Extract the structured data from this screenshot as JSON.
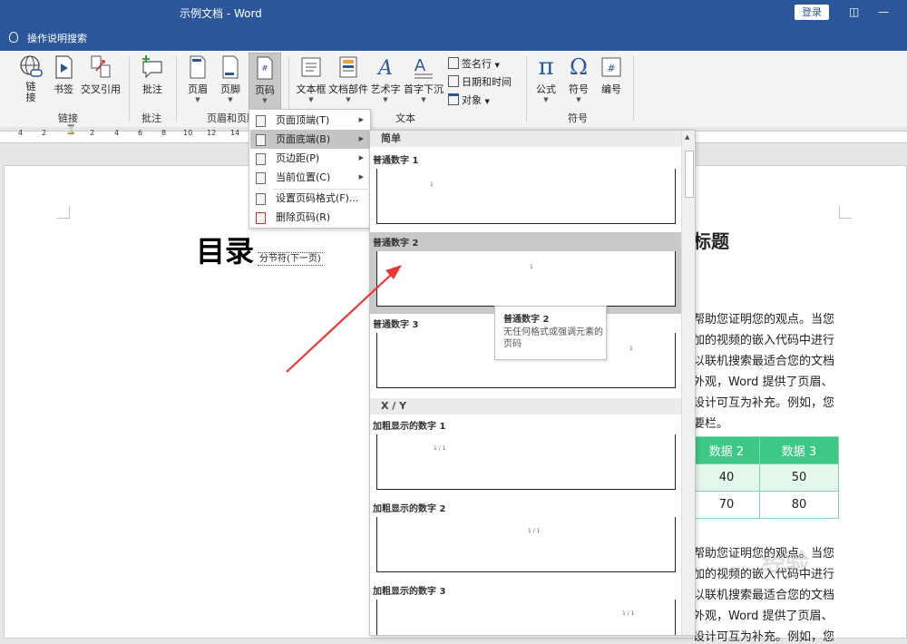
{
  "window": {
    "title": "示例文档 - Word",
    "login_label": "登录",
    "restore_icon": "ribbon-display-icon",
    "minimize_icon": "minimize-icon"
  },
  "tellme": {
    "label": "操作说明搜索"
  },
  "ribbon": {
    "links_group": {
      "label": "链接",
      "buttons": [
        "链\n接",
        "书签",
        "交叉引用"
      ]
    },
    "comments_group": {
      "label": "批注",
      "buttons": [
        "批注"
      ]
    },
    "header_footer_group": {
      "label": "页眉和页脚",
      "buttons": [
        "页眉",
        "页脚",
        "页码"
      ]
    },
    "text_group": {
      "label": "文本",
      "buttons": [
        "文本框",
        "文档部件",
        "艺术字",
        "首字下沉"
      ],
      "small_buttons": [
        "签名行",
        "日期和时间",
        "对象"
      ]
    },
    "symbols_group": {
      "label": "符号",
      "buttons": [
        "公式",
        "符号",
        "编号"
      ]
    }
  },
  "ruler": {
    "ticks": [
      "4",
      "2",
      "2",
      "4",
      "6",
      "8",
      "10",
      "12",
      "14"
    ]
  },
  "document": {
    "heading": "目录",
    "section_break": "分节符(下一页)",
    "heading_fragment": "标题",
    "paragraph1": [
      "帮助您证明您的观点。当您",
      "加的视频的嵌入代码中进行",
      "以联机搜索最适合您的文档",
      "外观，Word 提供了页眉、",
      "设计可互为补充。例如，您",
      "要栏。"
    ],
    "paragraph2": [
      "帮助您证明您的观点。当您",
      "加的视频的嵌入代码中进行",
      "以联机搜索最适合您的文档",
      "外观，Word 提供了页眉、",
      "设计可互为补充。例如，您"
    ],
    "table": {
      "headers": [
        "数据 2",
        "数据 3"
      ],
      "rows": [
        [
          "40",
          "50"
        ],
        [
          "70",
          "80"
        ]
      ]
    }
  },
  "context_menu": {
    "items": [
      "页面顶端(T)",
      "页面底端(B)",
      "页边距(P)",
      "当前位置(C)",
      "设置页码格式(F)...",
      "删除页码(R)"
    ],
    "selected_index": 1
  },
  "gallery": {
    "sections": [
      "简单",
      "X / Y"
    ],
    "items": [
      {
        "title": "普通数字 1",
        "number": "1"
      },
      {
        "title": "普通数字 2",
        "number": "1"
      },
      {
        "title": "普通数字 3",
        "number": "1"
      },
      {
        "title": "加粗显示的数字 1",
        "number": "1 / 1"
      },
      {
        "title": "加粗显示的数字 2",
        "number": "1 / 1"
      },
      {
        "title": "加粗显示的数字 3",
        "number": "1 / 1"
      }
    ],
    "highlighted_index": 1
  },
  "tooltip": {
    "title": "普通数字 2",
    "description": "无任何格式或强调元素的页码"
  },
  "watermark": "经验",
  "colors": {
    "title_bar": "#2b579a",
    "table_header": "#3ec888",
    "arrow": "#e53935"
  }
}
